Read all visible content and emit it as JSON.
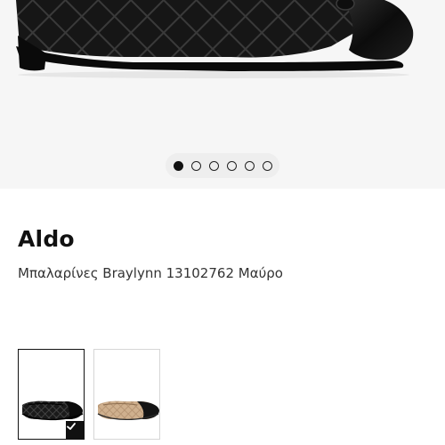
{
  "gallery": {
    "image_subject": "black quilted ballerina flat with patent cap toe",
    "pagination": {
      "total": 6,
      "current": 1
    }
  },
  "product": {
    "brand": "Aldo",
    "name": "Μπαλαρίνες Braylynn 13102762 Μαύρο"
  },
  "variants": [
    {
      "color": "black",
      "selected": true
    },
    {
      "color": "beige with black toe",
      "selected": false
    }
  ],
  "colors": {
    "shoe_black": "#141414",
    "beige": "#cfb08e",
    "background": "#f6f6f6"
  }
}
